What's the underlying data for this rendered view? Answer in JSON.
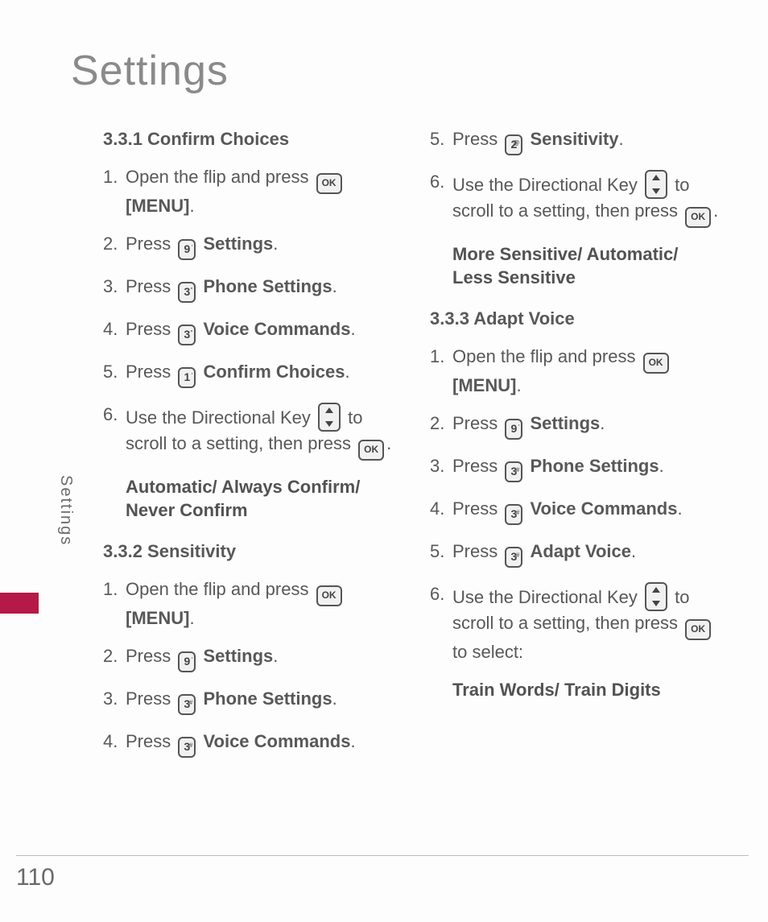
{
  "page_title": "Settings",
  "side_label": "Settings",
  "page_number": "110",
  "keys": {
    "ok": "OK",
    "k9": "9",
    "k3": "3",
    "k1": "1",
    "k2": "2"
  },
  "sec_331": {
    "heading": "3.3.1 Confirm Choices",
    "step1a": "Open the flip and press ",
    "step1b": "[MENU]",
    "step2a": "Press ",
    "step2b": "Settings",
    "step3a": "Press ",
    "step3b": "Phone Settings",
    "step4a": "Press ",
    "step4b": "Voice Commands",
    "step5a": "Press ",
    "step5b": "Confirm Choices",
    "step6a": "Use the Directional Key ",
    "step6b": " to scroll to a setting, then press ",
    "options": "Automatic/ Always Confirm/ Never Confirm"
  },
  "sec_332": {
    "heading": "3.3.2 Sensitivity",
    "step1a": "Open the flip and press ",
    "step1b": "[MENU]",
    "step2a": "Press ",
    "step2b": "Settings",
    "step3a": "Press ",
    "step3b": "Phone Settings",
    "step4a": "Press ",
    "step4b": "Voice Commands",
    "step5a": "Press ",
    "step5b": "Sensitivity",
    "step6a": "Use the Directional Key ",
    "step6b": " to scroll to a setting, then press ",
    "options": "More Sensitive/ Automatic/ Less Sensitive"
  },
  "sec_333": {
    "heading": "3.3.3 Adapt Voice",
    "step1a": "Open the flip and press ",
    "step1b": "[MENU]",
    "step2a": "Press ",
    "step2b": "Settings",
    "step3a": "Press ",
    "step3b": "Phone Settings",
    "step4a": "Press ",
    "step4b": "Voice Commands",
    "step5a": "Press ",
    "step5b": "Adapt Voice",
    "step6a": "Use the Directional Key ",
    "step6b": " to scroll to a setting, then press ",
    "step6c": " to select:",
    "options": "Train Words/ Train Digits"
  }
}
